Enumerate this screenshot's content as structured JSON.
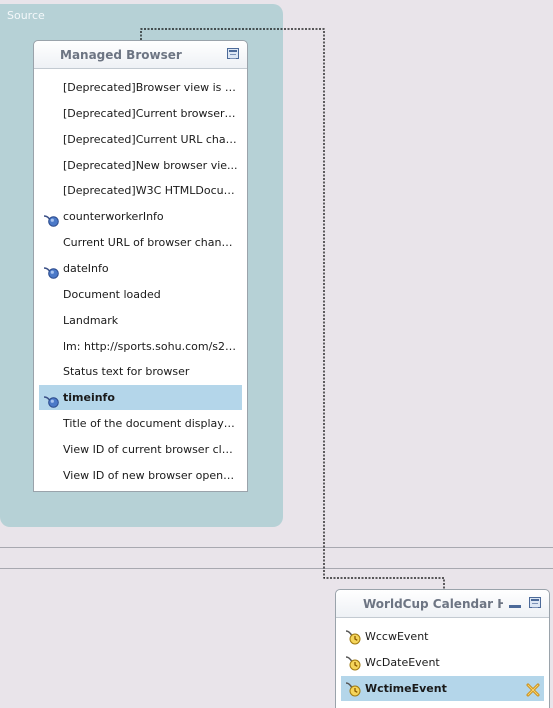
{
  "source_area": {
    "label": "Source"
  },
  "managed_browser": {
    "title": "Managed Browser",
    "items": [
      {
        "label": "[Deprecated]Browser view is cl...",
        "icon": "",
        "selected": false
      },
      {
        "label": "[Deprecated]Current browser t...",
        "icon": "",
        "selected": false
      },
      {
        "label": "[Deprecated]Current URL chan...",
        "icon": "",
        "selected": false
      },
      {
        "label": "[Deprecated]New browser vie...",
        "icon": "",
        "selected": false
      },
      {
        "label": "[Deprecated]W3C HTMLDocum...",
        "icon": "",
        "selected": false
      },
      {
        "label": "counterworkerInfo",
        "icon": "wired-data-icon",
        "selected": false
      },
      {
        "label": "Current URL of browser chang...",
        "icon": "",
        "selected": false
      },
      {
        "label": "dateInfo",
        "icon": "wired-data-icon",
        "selected": false
      },
      {
        "label": "Document loaded",
        "icon": "",
        "selected": false
      },
      {
        "label": "Landmark",
        "icon": "",
        "selected": false
      },
      {
        "label": "lm: http://sports.sohu.com/s20...",
        "icon": "",
        "selected": false
      },
      {
        "label": "Status text for browser",
        "icon": "",
        "selected": false
      },
      {
        "label": "timeinfo",
        "icon": "wired-data-icon",
        "selected": true
      },
      {
        "label": "Title of the document displayed...",
        "icon": "",
        "selected": false
      },
      {
        "label": "View ID of current browser clos...",
        "icon": "",
        "selected": false
      },
      {
        "label": "View ID of new browser opene...",
        "icon": "",
        "selected": false
      }
    ]
  },
  "calendar_panel": {
    "title": "WorldCup Calendar H...",
    "items": [
      {
        "label": "WccwEvent",
        "icon": "wired-event-icon",
        "selected": false
      },
      {
        "label": "WcDateEvent",
        "icon": "wired-event-icon",
        "selected": false
      },
      {
        "label": "WctimeEvent",
        "icon": "wired-event-icon",
        "selected": true,
        "action_icon": "delete-wire-icon"
      }
    ]
  },
  "colors": {
    "source_area": "#b6d1d6",
    "selection": "#b4d6ea",
    "canvas": "#e9e4ea",
    "wire": "#000000"
  }
}
